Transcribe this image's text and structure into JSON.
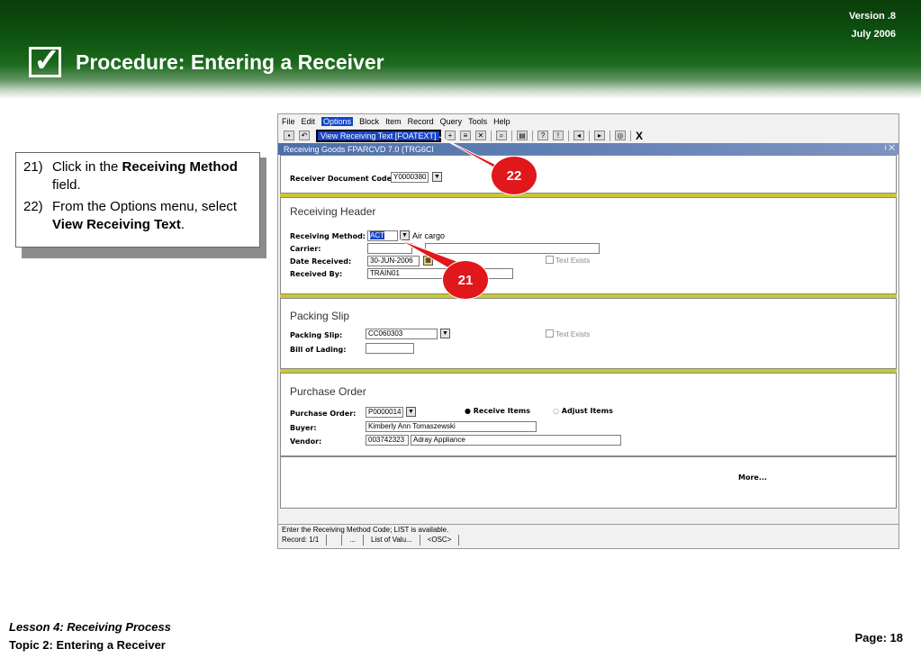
{
  "slide": {
    "version": "Version .8",
    "date": "July  2006",
    "title": "Procedure: Entering a Receiver",
    "lesson": "Lesson 4: Receiving Process",
    "topic": "Topic 2: Entering a Receiver",
    "page": "Page: 18"
  },
  "instructions": [
    {
      "num": "21)",
      "text_pre": "Click in the ",
      "bold": "Receiving Method",
      "text_post": " field."
    },
    {
      "num": "22)",
      "text_pre": "From the Options menu, select ",
      "bold": "View Receiving Text",
      "text_post": "."
    }
  ],
  "callouts": {
    "a": "22",
    "b": "21"
  },
  "app": {
    "menu": [
      "File",
      "Edit",
      "Options",
      "Block",
      "Item",
      "Record",
      "Query",
      "Tools",
      "Help"
    ],
    "selected_menu": "Options",
    "dropdown_item": "View Receiving Text [FOATEXT]",
    "close_label": "X",
    "form_title": "Receiving Goods  FPARCVD  7.0  (TRG6CI",
    "form_controls": "⫮ ✕",
    "receiver_doc_label": "Receiver Document Code",
    "receiver_doc_value": "Y0000380",
    "header_section": "Receiving Header",
    "receiving_method_label": "Receiving Method:",
    "receiving_method_value": "ACT",
    "receiving_method_desc": "Air cargo",
    "carrier_label": "Carrier:",
    "carrier_value": "",
    "date_received_label": "Date Received:",
    "date_received_value": "30-JUN-2006",
    "text_exists_label": "Text Exists",
    "received_by_label": "Received By:",
    "received_by_value": "TRAIN01",
    "packing_section": "Packing Slip",
    "packing_slip_label": "Packing Slip:",
    "packing_slip_value": "CC060303",
    "bill_of_lading_label": "Bill of Lading:",
    "bill_of_lading_value": "",
    "po_section": "Purchase Order",
    "po_label": "Purchase Order:",
    "po_value": "P0000014",
    "receive_items_label": "Receive Items",
    "adjust_items_label": "Adjust Items",
    "buyer_label": "Buyer:",
    "buyer_value": "Kimberly Ann  Tomaszewski",
    "vendor_label": "Vendor:",
    "vendor_id": "003742323",
    "vendor_name": "Adray Appliance",
    "more_label": "More...",
    "status_message": "Enter the Receiving Method Code; LIST is available.",
    "status_record": "Record: 1/1",
    "status_dots": "...",
    "status_list": "List of Valu...",
    "status_osc": "<OSC>"
  },
  "colors": {
    "header_green": "#0f5412",
    "callout_red": "#e0171b",
    "menu_select": "#1245c8",
    "separator_yellow": "#c8c832"
  }
}
